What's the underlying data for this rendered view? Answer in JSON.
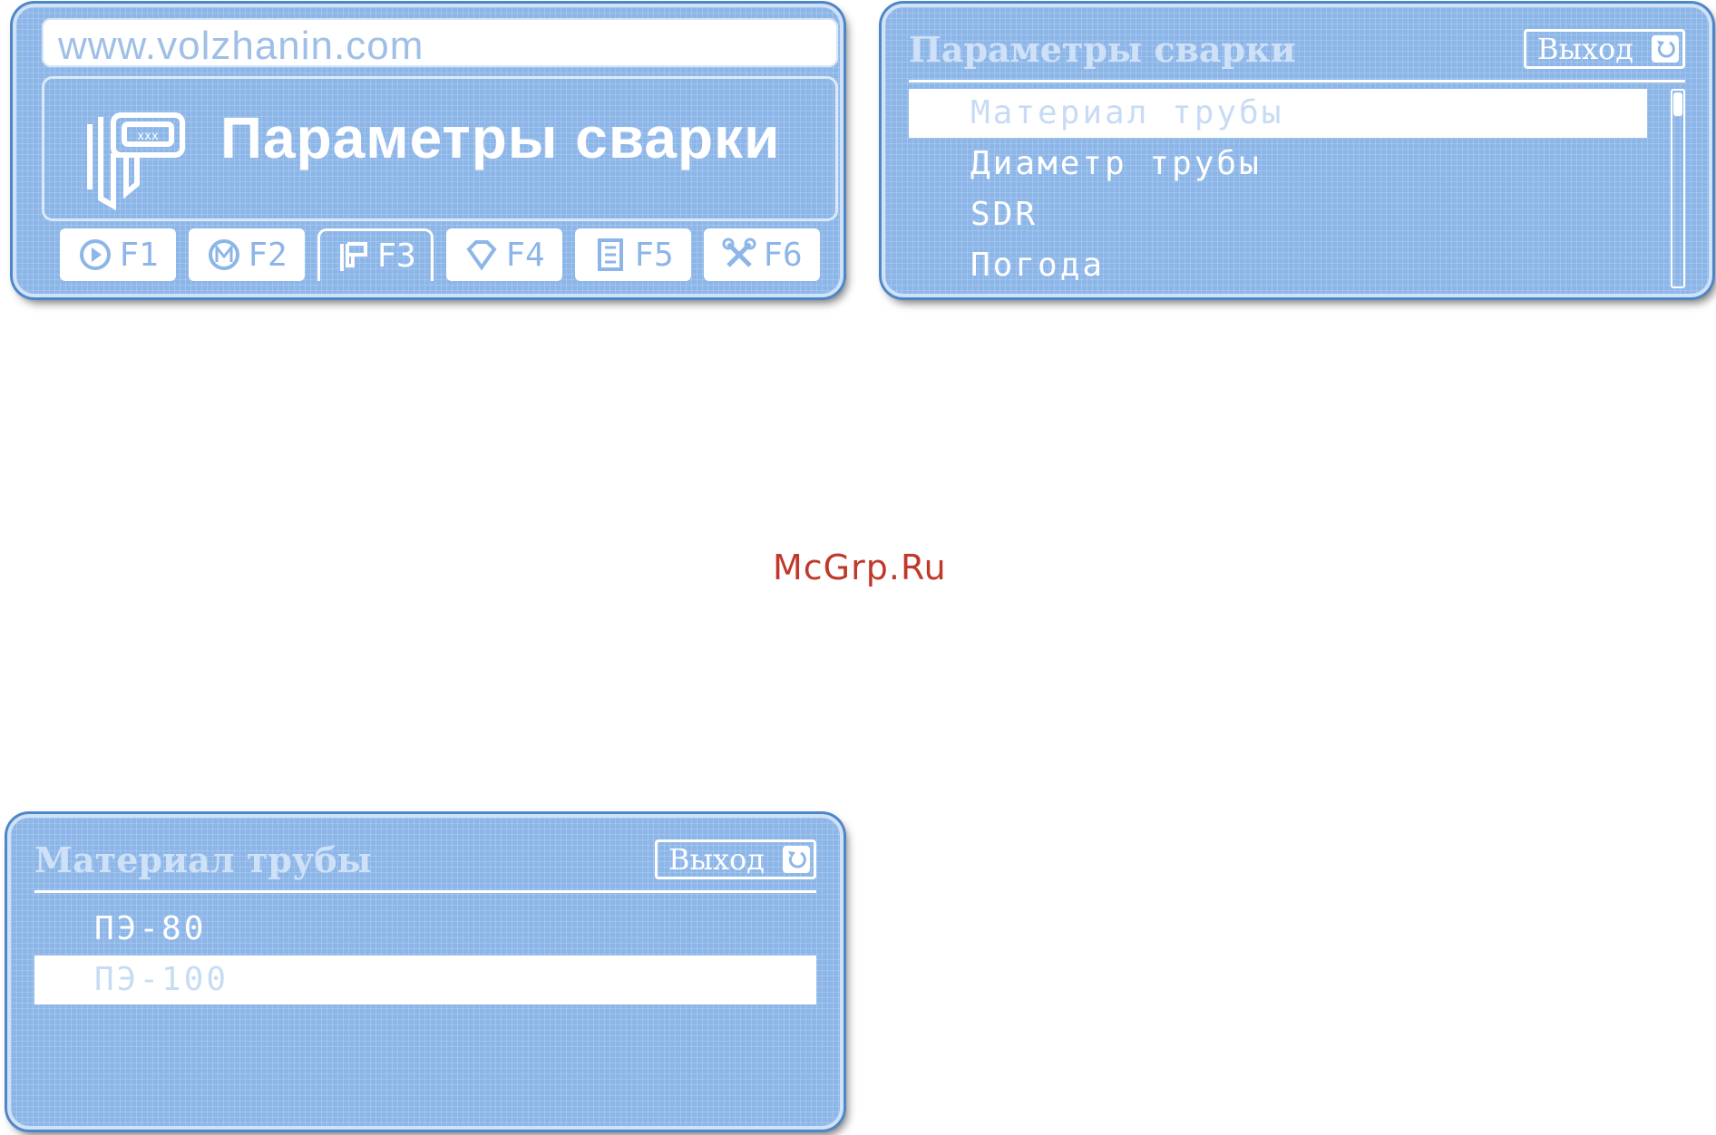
{
  "screen_main": {
    "url": "www.volzhanin.com",
    "title": "Параметры сварки",
    "function_keys": [
      {
        "label": "F1",
        "icon": "play-circle-icon",
        "active": false
      },
      {
        "label": "F2",
        "icon": "m-circle-icon",
        "active": false
      },
      {
        "label": "F3",
        "icon": "caliper-icon",
        "active": true
      },
      {
        "label": "F4",
        "icon": "diamond-icon",
        "active": false
      },
      {
        "label": "F5",
        "icon": "archive-icon",
        "active": false
      },
      {
        "label": "F6",
        "icon": "tools-icon",
        "active": false
      }
    ]
  },
  "screen_params": {
    "title": "Параметры сварки",
    "exit_label": "Выход",
    "items": [
      "Материал трубы",
      "Диаметр трубы",
      "SDR",
      "Погода"
    ],
    "selected_index": 0
  },
  "screen_material": {
    "title": "Материал трубы",
    "exit_label": "Выход",
    "items": [
      "ПЭ-80",
      "ПЭ-100"
    ],
    "selected_index": 1
  },
  "watermark": "McGrp.Ru",
  "colors": {
    "lcd_background": "#8db6e8",
    "lcd_foreground": "#ffffff",
    "watermark": "#c0392b"
  }
}
